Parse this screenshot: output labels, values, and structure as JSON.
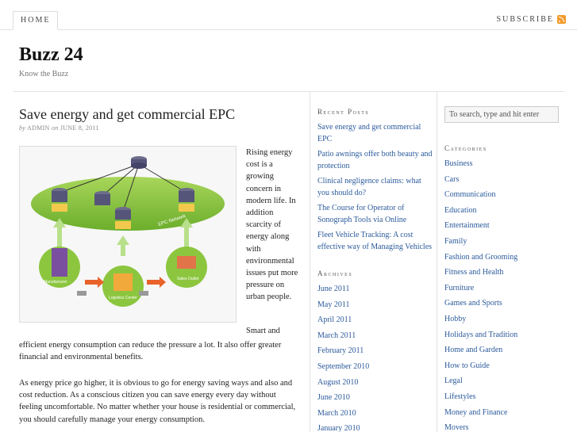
{
  "topbar": {
    "home_label": "HOME",
    "subscribe_label": "SUBSCRIBE"
  },
  "header": {
    "site_title": "Buzz 24",
    "tagline": "Know the Buzz"
  },
  "post": {
    "title": "Save energy and get commercial EPC",
    "byline_prefix": "by",
    "author": "ADMIN",
    "byline_on": "on",
    "date": "JUNE 8, 2011",
    "side_lines": [
      "Rising energy",
      "cost is a",
      "growing",
      "concern in",
      "modern life. In",
      "addition",
      "scarcity of",
      "energy along",
      "with",
      "environmental",
      "issues put more",
      "pressure on",
      "urban people."
    ],
    "after_figure": "Smart and",
    "para1": "efficient energy consumption can reduce the pressure a lot. It also offer greater financial and environmental benefits.",
    "para2": "As energy price go higher, it is obvious to go for energy saving ways and also and cost reduction. As a conscious citizen you can save energy every day without feeling uncomfortable. No matter whether your house is residential or commercial, you should carefully manage your energy consumption.",
    "figure_labels": {
      "network": "EPC Network",
      "manufacturer": "Manufacturer",
      "logistics": "Logistics Center",
      "sales": "Sales Outlet",
      "epc": "EPCIS"
    }
  },
  "recent_posts": {
    "title": "Recent Posts",
    "items": [
      "Save energy and get commercial EPC",
      "Patio awnings offer both beauty and protection",
      "Clinical negligence claims: what you should do?",
      "The Course for Operator of Sonograph Tools via Online",
      "Fleet Vehicle Tracking: A cost effective way of Managing Vehicles"
    ]
  },
  "archives": {
    "title": "Archives",
    "items": [
      "June 2011",
      "May 2011",
      "April 2011",
      "March 2011",
      "February 2011",
      "September 2010",
      "August 2010",
      "June 2010",
      "March 2010",
      "January 2010"
    ]
  },
  "search": {
    "placeholder": "To search, type and hit enter"
  },
  "categories": {
    "title": "Categories",
    "items": [
      "Business",
      "Cars",
      "Communication",
      "Education",
      "Entertainment",
      "Family",
      "Fashion and Grooming",
      "Fitness and Health",
      "Furniture",
      "Games and Sports",
      "Hobby",
      "Holidays and Tradition",
      "Home and Garden",
      "How to Guide",
      "Legal",
      "Lifestyles",
      "Money and Finance",
      "Movers"
    ]
  },
  "colors": {
    "link": "#2b5a9b",
    "rss": "#f39a2b",
    "network_green": "#8cc63f"
  }
}
